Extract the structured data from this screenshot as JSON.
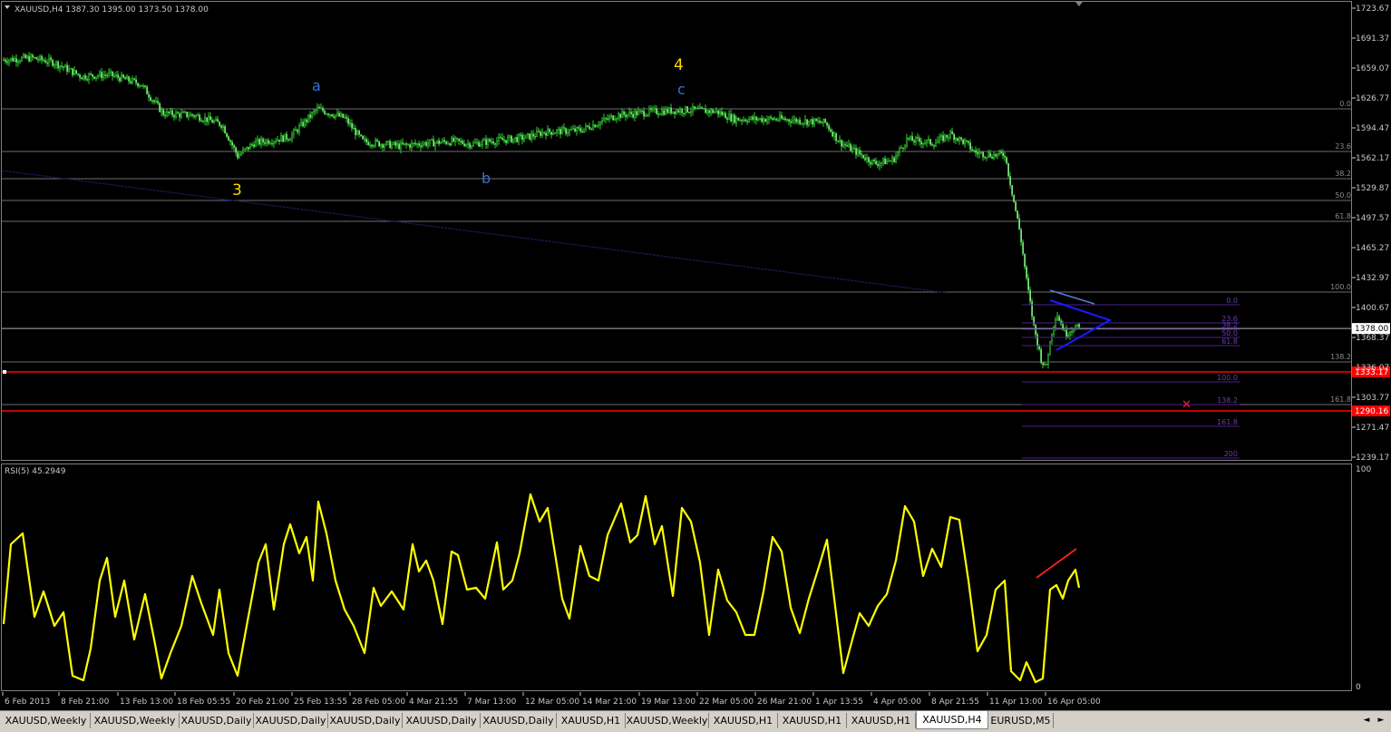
{
  "main": {
    "title": "XAUUSD,H4  1387.30 1395.00 1373.50 1378.00",
    "price_axis": [
      "1723.67",
      "1691.37",
      "1659.07",
      "1626.77",
      "1594.47",
      "1562.17",
      "1529.87",
      "1497.57",
      "1465.27",
      "1432.97",
      "1400.67",
      "1368.37",
      "1336.07",
      "1303.77",
      "1271.47",
      "1239.17"
    ],
    "current_price": "1378.00",
    "level_high": "1333.17",
    "level_low": "1290.16",
    "left_fib": [
      "0.0",
      "23.6",
      "38.2",
      "50.0",
      "61.8",
      "100.0",
      "138.2",
      "161.8"
    ],
    "right_fib": [
      "0.0",
      "23.6",
      "38.2",
      "50.0",
      "61.8",
      "100.0",
      "138.2",
      "161.8",
      "200"
    ],
    "waves": {
      "w3": "3",
      "w4": "4",
      "a": "a",
      "b": "b",
      "c": "c"
    },
    "colors": {
      "candle": "#32cd32",
      "level": "#ff0000",
      "rsi": "#ffff00",
      "wave_yellow": "#ffd700",
      "wave_blue": "#3b6fd6",
      "triangle": "#1a1aff"
    }
  },
  "rsi": {
    "title": "RSI(5) 45.2949",
    "axis_top": "100",
    "axis_bottom": "0"
  },
  "time_axis": [
    "6 Feb 2013",
    "8 Feb 21:00",
    "13 Feb 13:00",
    "18 Feb 05:55",
    "20 Feb 21:00",
    "25 Feb 13:55",
    "28 Feb 05:00",
    "4 Mar 21:55",
    "7 Mar 13:00",
    "12 Mar 05:00",
    "14 Mar 21:00",
    "19 Mar 13:00",
    "22 Mar 05:00",
    "26 Mar 21:00",
    "1 Apr 13:55",
    "4 Apr 05:00",
    "8 Apr 21:55",
    "11 Apr 13:00",
    "16 Apr 05:00"
  ],
  "tabs": [
    "XAUUSD,Weekly",
    "XAUUSD,Weekly",
    "XAUUSD,Daily",
    "XAUUSD,Daily",
    "XAUUSD,Daily",
    "XAUUSD,Daily",
    "XAUUSD,Daily",
    "XAUUSD,H1",
    "XAUUSD,Weekly",
    "XAUUSD,H1",
    "XAUUSD,H1",
    "XAUUSD,H1",
    "XAUUSD,H4",
    "EURUSD,M5"
  ],
  "active_tab": 12
}
